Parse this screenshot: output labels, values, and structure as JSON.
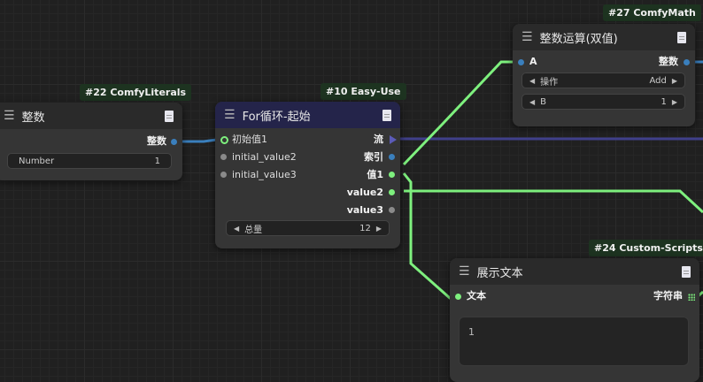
{
  "colors": {
    "int_wire": "#3a7fbd",
    "flow_wire": "#3f3f8a",
    "value_wire": "#7ef07e"
  },
  "nodes": {
    "literals": {
      "badge": "#22 ComfyLiterals",
      "title": "整数",
      "output": "整数",
      "widget": {
        "label": "Number",
        "value": "1"
      }
    },
    "forloop": {
      "badge": "#10 Easy-Use",
      "title": "For循环-起始",
      "inputs": [
        "初始值1",
        "initial_value2",
        "initial_value3"
      ],
      "outputs": [
        "流",
        "索引",
        "值1",
        "value2",
        "value3"
      ],
      "widget": {
        "label": "总量",
        "value": "12"
      }
    },
    "math": {
      "badge": "#27 ComfyMath",
      "title": "整数运算(双值)",
      "input": "A",
      "output": "整数",
      "widgets": [
        {
          "label": "操作",
          "value": "Add"
        },
        {
          "label": "B",
          "value": "1"
        }
      ]
    },
    "show": {
      "badge": "#24 Custom-Scripts",
      "title": "展示文本",
      "input": "文本",
      "output": "字符串",
      "text": "1"
    }
  }
}
